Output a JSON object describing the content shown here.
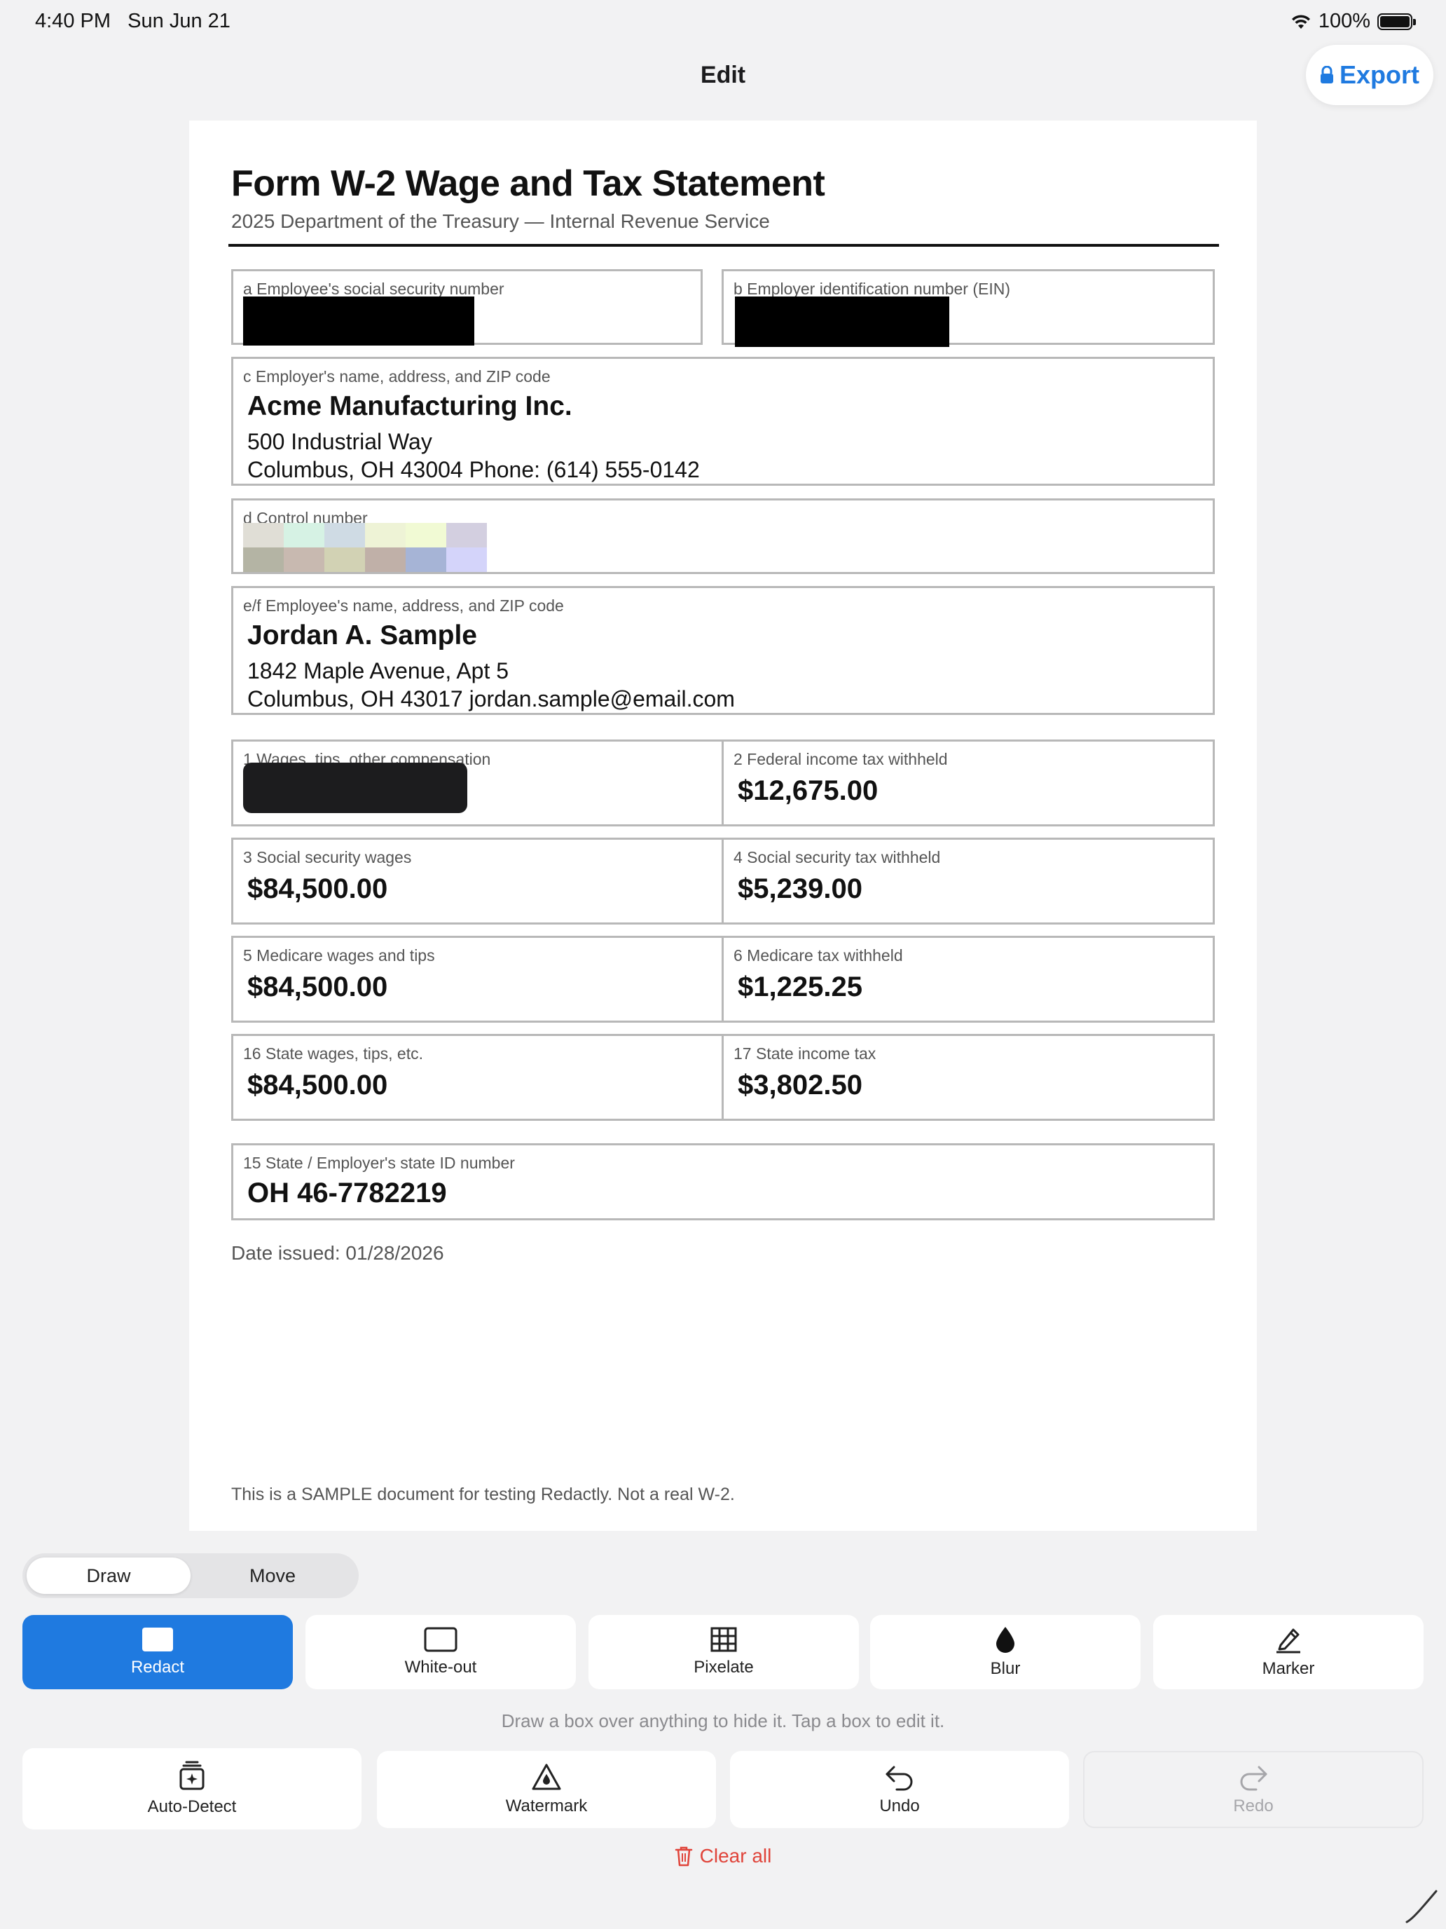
{
  "status_bar": {
    "time": "4:40 PM",
    "date": "Sun Jun 21",
    "battery": "100%"
  },
  "nav": {
    "title": "Edit",
    "export_label": "Export"
  },
  "document": {
    "title": "Form W-2  Wage and Tax Statement",
    "subtitle": "2025   Department of the Treasury — Internal Revenue Service",
    "box_a": {
      "label": "a  Employee's social security number"
    },
    "box_b": {
      "label": "b  Employer identification number (EIN)"
    },
    "box_c": {
      "label": "c  Employer's name, address, and ZIP code",
      "name": "Acme Manufacturing Inc.",
      "line1": "500 Industrial Way",
      "line2": "Columbus, OH 43004    Phone: (614) 555-0142"
    },
    "box_d": {
      "label": "d  Control number"
    },
    "box_ef": {
      "label": "e/f  Employee's name, address, and ZIP code",
      "name": "Jordan A. Sample",
      "line1": "1842 Maple Avenue, Apt 5",
      "line2": "Columbus, OH 43017    jordan.sample@email.com"
    },
    "box_1": {
      "label": "1  Wages, tips, other compensation"
    },
    "box_2": {
      "label": "2  Federal income tax withheld",
      "value": "$12,675.00"
    },
    "box_3": {
      "label": "3  Social security wages",
      "value": "$84,500.00"
    },
    "box_4": {
      "label": "4  Social security tax withheld",
      "value": "$5,239.00"
    },
    "box_5": {
      "label": "5  Medicare wages and tips",
      "value": "$84,500.00"
    },
    "box_6": {
      "label": "6  Medicare tax withheld",
      "value": "$1,225.25"
    },
    "box_16": {
      "label": "16  State wages, tips, etc.",
      "value": "$84,500.00"
    },
    "box_17": {
      "label": "17  State income tax",
      "value": "$3,802.50"
    },
    "box_15": {
      "label": "15  State / Employer's state ID number",
      "value": "OH  46-7782219"
    },
    "date_issued": "Date issued: 01/28/2026",
    "disclaimer": "This is a SAMPLE document for testing Redactly. Not a real W-2."
  },
  "pixelate_colors": [
    "#e0ded6",
    "#d6f2e4",
    "#cfdbe4",
    "#eef3d6",
    "#f1fad4",
    "#d3cfe0",
    "#b4b4a4",
    "#c8b9b0",
    "#d2d2b4",
    "#c0b0a8",
    "#a6b4d6",
    "#d4d4fa"
  ],
  "mode_toggle": {
    "draw": "Draw",
    "move": "Move",
    "selected": "Draw"
  },
  "tools": {
    "redact": "Redact",
    "whiteout": "White-out",
    "pixelate": "Pixelate",
    "blur": "Blur",
    "marker": "Marker",
    "selected": "Redact"
  },
  "hint": "Draw a box over anything to hide it. Tap a box to edit it.",
  "actions": {
    "auto_detect": "Auto-Detect",
    "watermark": "Watermark",
    "undo": "Undo",
    "redo": "Redo"
  },
  "clear_all": "Clear all",
  "colors": {
    "accent": "#1f7ae0",
    "destructive": "#e0443a",
    "background": "#f2f2f3"
  }
}
